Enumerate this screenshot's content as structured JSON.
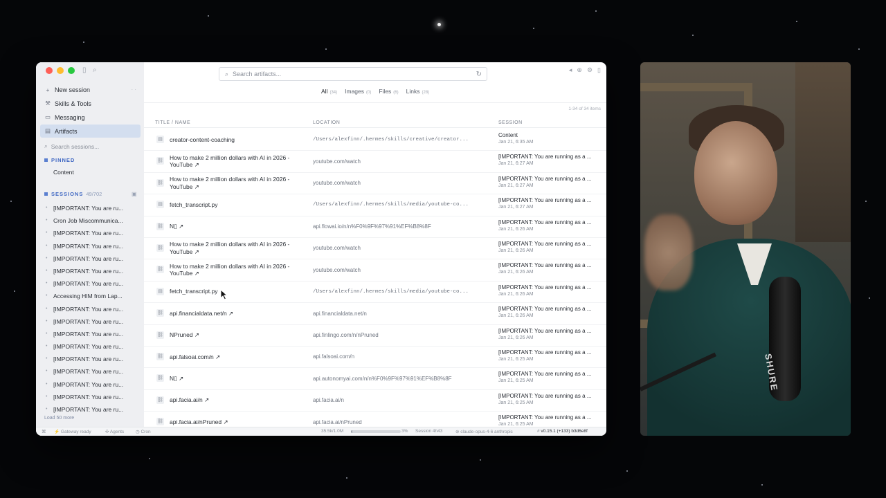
{
  "sidebar": {
    "nav": [
      {
        "label": "New session",
        "icon": "plus-icon",
        "extra": "· ·"
      },
      {
        "label": "Skills & Tools",
        "icon": "wrench-icon"
      },
      {
        "label": "Messaging",
        "icon": "chat-icon"
      },
      {
        "label": "Artifacts",
        "icon": "document-icon",
        "active": true
      }
    ],
    "search_placeholder": "Search sessions...",
    "pinned_header": "PINNED",
    "pinned_items": [
      "Content"
    ],
    "sessions_header": "SESSIONS",
    "sessions_count": "49/702",
    "sessions": [
      "[IMPORTANT: You are ru...",
      "Cron Job Miscommunica...",
      "[IMPORTANT: You are ru...",
      "[IMPORTANT: You are ru...",
      "[IMPORTANT: You are ru...",
      "[IMPORTANT: You are ru...",
      "[IMPORTANT: You are ru...",
      "Accessing HIM from Lap...",
      "[IMPORTANT: You are ru...",
      "[IMPORTANT: You are ru...",
      "[IMPORTANT: You are ru...",
      "[IMPORTANT: You are ru...",
      "[IMPORTANT: You are ru...",
      "[IMPORTANT: You are ru...",
      "[IMPORTANT: You are ru...",
      "[IMPORTANT: You are ru...",
      "[IMPORTANT: You are ru..."
    ],
    "load_more": "Load 50 more"
  },
  "main": {
    "search_placeholder": "Search artifacts...",
    "filters": [
      {
        "label": "All",
        "count": "(34)",
        "active": true
      },
      {
        "label": "Images",
        "count": "(0)"
      },
      {
        "label": "Files",
        "count": "(6)"
      },
      {
        "label": "Links",
        "count": "(28)"
      }
    ],
    "items_count": "1-34 of 34 items",
    "columns": {
      "title": "TITLE / NAME",
      "location": "LOCATION",
      "session": "SESSION"
    },
    "rows": [
      {
        "type": "file",
        "title": "creator-content-coaching",
        "location": "/Users/alexfinn/.hermes/skills/creative/creator...",
        "session": "Content",
        "date": "Jan 21, 6:35 AM"
      },
      {
        "type": "link",
        "title": "How to make 2 million dollars with AI in 2026 - YouTube ↗",
        "location": "youtube.com/watch",
        "session": "[IMPORTANT: You are running as a ...",
        "date": "Jan 21, 6:27 AM"
      },
      {
        "type": "link",
        "title": "How to make 2 million dollars with AI in 2026 - YouTube ↗",
        "location": "youtube.com/watch",
        "session": "[IMPORTANT: You are running as a ...",
        "date": "Jan 21, 6:27 AM"
      },
      {
        "type": "file",
        "title": "fetch_transcript.py",
        "location": "/Users/alexfinn/.hermes/skills/media/youtube-co...",
        "session": "[IMPORTANT: You are running as a ...",
        "date": "Jan 21, 6:27 AM"
      },
      {
        "type": "link",
        "title": "N▯ ↗",
        "location": "api.flowai.io/n/n%F0%9F%97%91%EF%B8%8F",
        "session": "[IMPORTANT: You are running as a ...",
        "date": "Jan 21, 6:26 AM"
      },
      {
        "type": "link",
        "title": "How to make 2 million dollars with AI in 2026 - YouTube ↗",
        "location": "youtube.com/watch",
        "session": "[IMPORTANT: You are running as a ...",
        "date": "Jan 21, 6:26 AM"
      },
      {
        "type": "link",
        "title": "How to make 2 million dollars with AI in 2026 - YouTube ↗",
        "location": "youtube.com/watch",
        "session": "[IMPORTANT: You are running as a ...",
        "date": "Jan 21, 6:26 AM"
      },
      {
        "type": "file",
        "title": "fetch_transcript.py",
        "location": "/Users/alexfinn/.hermes/skills/media/youtube-co...",
        "session": "[IMPORTANT: You are running as a ...",
        "date": "Jan 21, 6:26 AM"
      },
      {
        "type": "link",
        "title": "api.financialdata.net/n ↗",
        "location": "api.financialdata.net/n",
        "session": "[IMPORTANT: You are running as a ...",
        "date": "Jan 21, 6:26 AM"
      },
      {
        "type": "link",
        "title": "NPruned ↗",
        "location": "api.finlingo.com/n/nPruned",
        "session": "[IMPORTANT: You are running as a ...",
        "date": "Jan 21, 6:26 AM"
      },
      {
        "type": "link",
        "title": "api.falsoai.com/n ↗",
        "location": "api.falsoai.com/n",
        "session": "[IMPORTANT: You are running as a ...",
        "date": "Jan 21, 6:25 AM"
      },
      {
        "type": "link",
        "title": "N▯ ↗",
        "location": "api.autonomyai.com/n/n%F0%9F%97%91%EF%B8%8F",
        "session": "[IMPORTANT: You are running as a ...",
        "date": "Jan 21, 6:25 AM"
      },
      {
        "type": "link",
        "title": "api.facia.ai/n ↗",
        "location": "api.facia.ai/n",
        "session": "[IMPORTANT: You are running as a ...",
        "date": "Jan 21, 6:25 AM"
      },
      {
        "type": "link",
        "title": "api.facia.ai/nPruned ↗",
        "location": "api.facia.ai/nPruned",
        "session": "[IMPORTANT: You are running as a ...",
        "date": "Jan 21, 6:25 AM"
      }
    ]
  },
  "status_bar": {
    "gateway": "Gateway ready",
    "agents": "Agents",
    "cron": "Cron",
    "tokens": "35.5k/1.0M",
    "usage_percent": 3,
    "usage_label": "3%",
    "session": "Session 4h43",
    "model": "claude-opus-4-6 anthropic",
    "version": "v0.15.1 (+133) b3d6e8f"
  },
  "webcam": {
    "mic_label": "SHURE"
  }
}
